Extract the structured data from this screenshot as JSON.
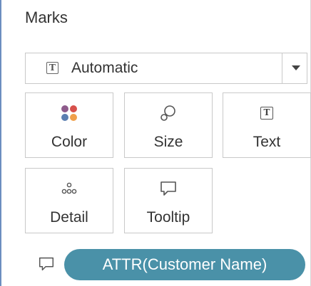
{
  "marks_pane": {
    "title": "Marks",
    "mark_type": {
      "icon": "text-mark-icon",
      "glyph": "T",
      "selected": "Automatic"
    },
    "cards": [
      {
        "id": "color",
        "label": "Color",
        "icon": "color-dots-icon"
      },
      {
        "id": "size",
        "label": "Size",
        "icon": "size-icon"
      },
      {
        "id": "text",
        "label": "Text",
        "icon": "text-icon",
        "glyph": "T"
      },
      {
        "id": "detail",
        "label": "Detail",
        "icon": "detail-icon"
      },
      {
        "id": "tooltip",
        "label": "Tooltip",
        "icon": "tooltip-icon"
      }
    ],
    "field_pill": {
      "label": "ATTR(Customer Name)",
      "icon": "tooltip-icon",
      "color": "#4a91a8"
    },
    "colors": {
      "dot_purple": "#8e5b8c",
      "dot_red": "#d7504b",
      "dot_blue": "#5b7fb1",
      "dot_orange": "#f0a04b"
    }
  }
}
